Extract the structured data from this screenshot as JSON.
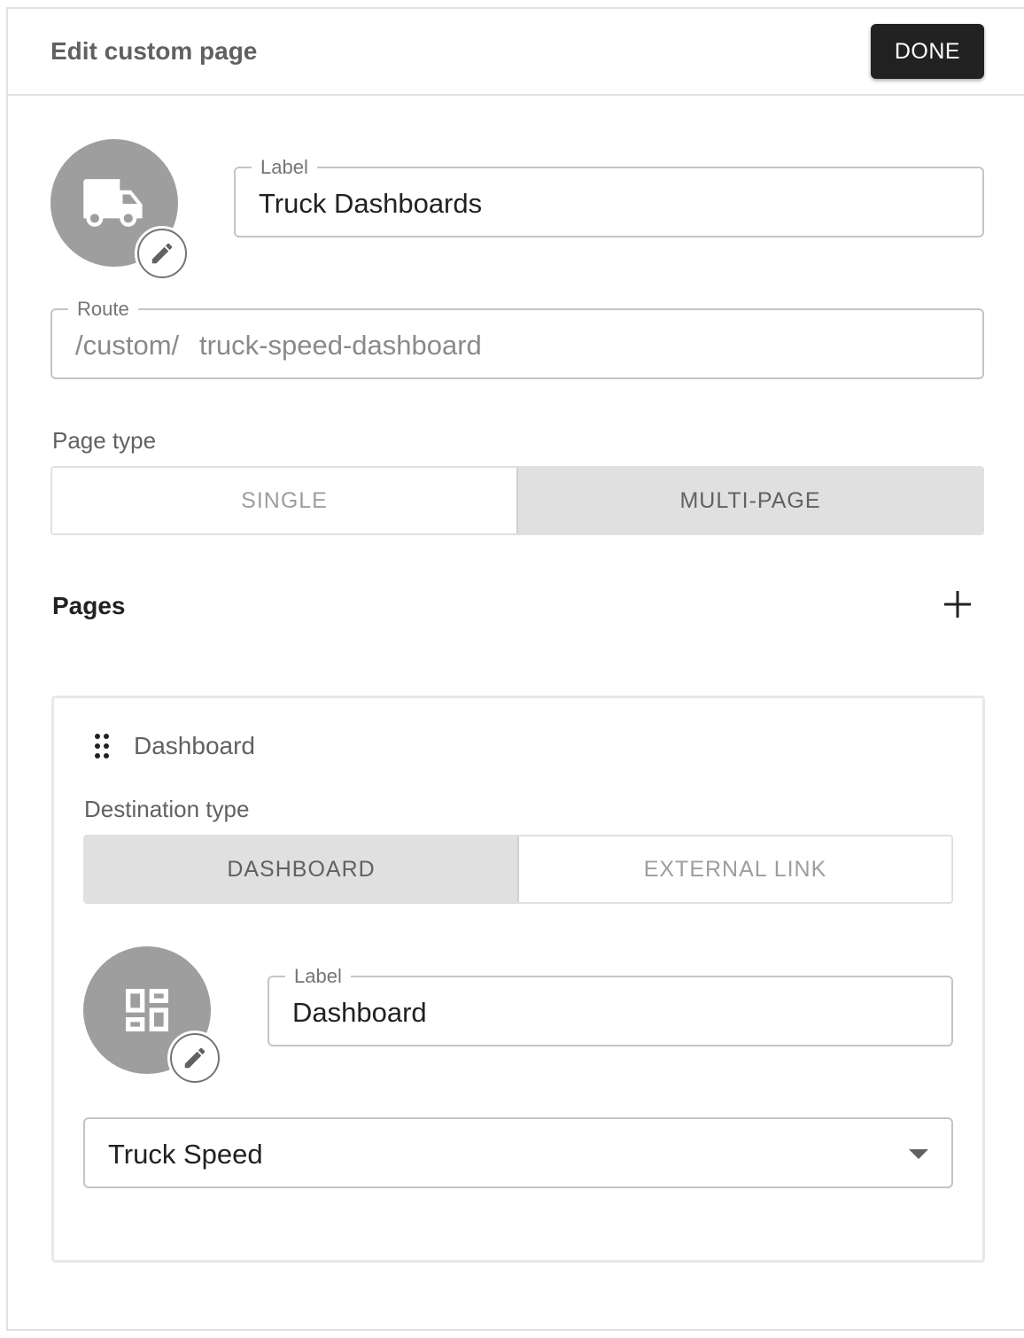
{
  "header": {
    "title": "Edit custom page",
    "done_label": "DONE"
  },
  "custom_page": {
    "icon": "truck-icon",
    "label_legend": "Label",
    "label_value": "Truck Dashboards",
    "route_legend": "Route",
    "route_prefix": "/custom/",
    "route_value": "truck-speed-dashboard",
    "page_type_label": "Page type",
    "page_type_options": [
      "SINGLE",
      "MULTI-PAGE"
    ],
    "page_type_selected": "MULTI-PAGE"
  },
  "pages": {
    "title": "Pages",
    "add_icon": "plus-icon",
    "items": [
      {
        "name": "Dashboard",
        "destination_type_label": "Destination type",
        "destination_options": [
          "DASHBOARD",
          "EXTERNAL LINK"
        ],
        "destination_selected": "DASHBOARD",
        "icon": "dashboard-icon",
        "label_legend": "Label",
        "label_value": "Dashboard",
        "dashboard_selected": "Truck Speed"
      }
    ]
  },
  "colors": {
    "primary_button": "#212121",
    "avatar_bg": "#9e9e9e",
    "active_toggle_bg": "#e0e0e0"
  }
}
